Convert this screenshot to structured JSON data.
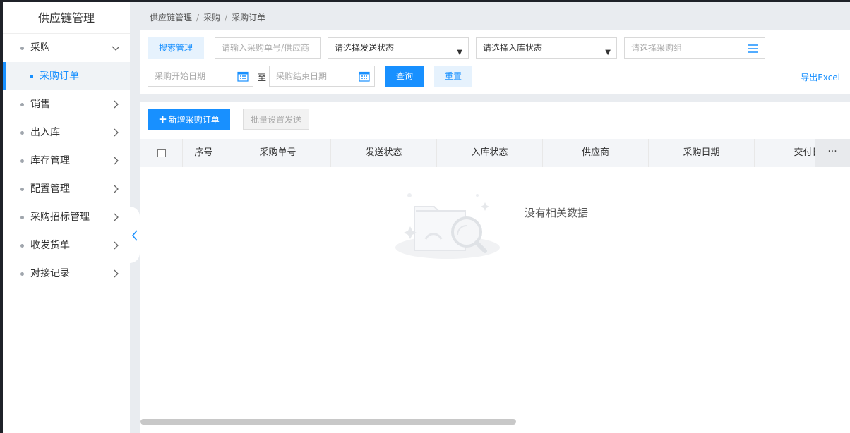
{
  "sidebar": {
    "title": "供应链管理",
    "items": [
      {
        "label": "采购",
        "expanded": true
      },
      {
        "label": "采购订单",
        "active": true
      },
      {
        "label": "销售"
      },
      {
        "label": "出入库"
      },
      {
        "label": "库存管理"
      },
      {
        "label": "配置管理"
      },
      {
        "label": "采购招标管理"
      },
      {
        "label": "收发货单"
      },
      {
        "label": "对接记录"
      }
    ]
  },
  "breadcrumb": [
    "供应链管理",
    "采购",
    "采购订单"
  ],
  "search": {
    "tab_label": "搜索管理",
    "order_placeholder": "请输入采购单号/供应商",
    "send_status": "请选择发送状态",
    "in_status": "请选择入库状态",
    "group_placeholder": "请选择采购组",
    "start_date_placeholder": "采购开始日期",
    "to_label": "至",
    "end_date_placeholder": "采购结束日期",
    "query_label": "查询",
    "reset_label": "重置",
    "export_label": "导出Excel"
  },
  "toolbar": {
    "add_label": "新增采购订单",
    "batch_label": "批量设置发送"
  },
  "table": {
    "columns": [
      "序号",
      "采购单号",
      "发送状态",
      "入库状态",
      "供应商",
      "采购日期",
      "交付日"
    ],
    "more_label": "···",
    "empty_text": "没有相关数据"
  },
  "colors": {
    "accent": "#1890ff",
    "accent_light": "#e6f2fd"
  }
}
